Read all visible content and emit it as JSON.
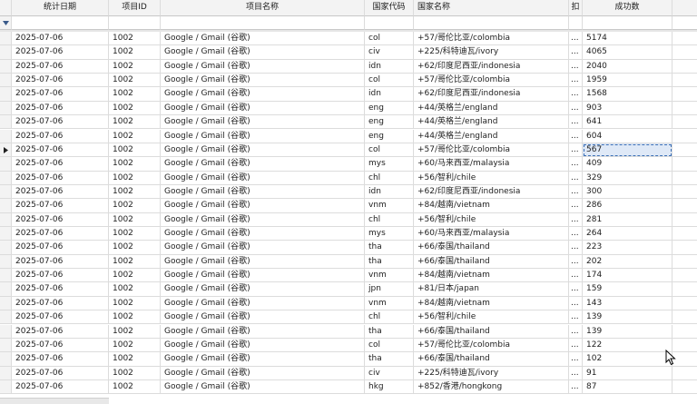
{
  "columns": {
    "date": "统计日期",
    "project_id": "项目ID",
    "project_name": "项目名称",
    "country_code": "国家代码",
    "country_name": "国家名称",
    "d": "扣",
    "success_count": "成功数"
  },
  "filter_icon": "filter-dropdown-icon",
  "row_indicator_icon": "row-pointer-icon",
  "selected_row_index": 8,
  "rows": [
    {
      "date": "2025-07-06",
      "pid": "1002",
      "pname": "Google / Gmail (谷歌)",
      "ccode": "col",
      "cname": "+57/哥伦比亚/colombia",
      "d": "...",
      "ok": "5174"
    },
    {
      "date": "2025-07-06",
      "pid": "1002",
      "pname": "Google / Gmail (谷歌)",
      "ccode": "civ",
      "cname": "+225/科特迪瓦/ivory",
      "d": "...",
      "ok": "4065"
    },
    {
      "date": "2025-07-06",
      "pid": "1002",
      "pname": "Google / Gmail (谷歌)",
      "ccode": "idn",
      "cname": "+62/印度尼西亚/indonesia",
      "d": "...",
      "ok": "2040"
    },
    {
      "date": "2025-07-06",
      "pid": "1002",
      "pname": "Google / Gmail (谷歌)",
      "ccode": "col",
      "cname": "+57/哥伦比亚/colombia",
      "d": "...",
      "ok": "1959"
    },
    {
      "date": "2025-07-06",
      "pid": "1002",
      "pname": "Google / Gmail (谷歌)",
      "ccode": "idn",
      "cname": "+62/印度尼西亚/indonesia",
      "d": "...",
      "ok": "1568"
    },
    {
      "date": "2025-07-06",
      "pid": "1002",
      "pname": "Google / Gmail (谷歌)",
      "ccode": "eng",
      "cname": "+44/英格兰/england",
      "d": "...",
      "ok": "903"
    },
    {
      "date": "2025-07-06",
      "pid": "1002",
      "pname": "Google / Gmail (谷歌)",
      "ccode": "eng",
      "cname": "+44/英格兰/england",
      "d": "...",
      "ok": "641"
    },
    {
      "date": "2025-07-06",
      "pid": "1002",
      "pname": "Google / Gmail (谷歌)",
      "ccode": "eng",
      "cname": "+44/英格兰/england",
      "d": "...",
      "ok": "604"
    },
    {
      "date": "2025-07-06",
      "pid": "1002",
      "pname": "Google / Gmail (谷歌)",
      "ccode": "col",
      "cname": "+57/哥伦比亚/colombia",
      "d": "...",
      "ok": "567"
    },
    {
      "date": "2025-07-06",
      "pid": "1002",
      "pname": "Google / Gmail (谷歌)",
      "ccode": "mys",
      "cname": "+60/马来西亚/malaysia",
      "d": "...",
      "ok": "409"
    },
    {
      "date": "2025-07-06",
      "pid": "1002",
      "pname": "Google / Gmail (谷歌)",
      "ccode": "chl",
      "cname": "+56/智利/chile",
      "d": "...",
      "ok": "329"
    },
    {
      "date": "2025-07-06",
      "pid": "1002",
      "pname": "Google / Gmail (谷歌)",
      "ccode": "idn",
      "cname": "+62/印度尼西亚/indonesia",
      "d": "...",
      "ok": "300"
    },
    {
      "date": "2025-07-06",
      "pid": "1002",
      "pname": "Google / Gmail (谷歌)",
      "ccode": "vnm",
      "cname": "+84/越南/vietnam",
      "d": "...",
      "ok": "286"
    },
    {
      "date": "2025-07-06",
      "pid": "1002",
      "pname": "Google / Gmail (谷歌)",
      "ccode": "chl",
      "cname": "+56/智利/chile",
      "d": "...",
      "ok": "281"
    },
    {
      "date": "2025-07-06",
      "pid": "1002",
      "pname": "Google / Gmail (谷歌)",
      "ccode": "mys",
      "cname": "+60/马来西亚/malaysia",
      "d": "...",
      "ok": "264"
    },
    {
      "date": "2025-07-06",
      "pid": "1002",
      "pname": "Google / Gmail (谷歌)",
      "ccode": "tha",
      "cname": "+66/泰国/thailand",
      "d": "...",
      "ok": "223"
    },
    {
      "date": "2025-07-06",
      "pid": "1002",
      "pname": "Google / Gmail (谷歌)",
      "ccode": "tha",
      "cname": "+66/泰国/thailand",
      "d": "...",
      "ok": "202"
    },
    {
      "date": "2025-07-06",
      "pid": "1002",
      "pname": "Google / Gmail (谷歌)",
      "ccode": "vnm",
      "cname": "+84/越南/vietnam",
      "d": "...",
      "ok": "174"
    },
    {
      "date": "2025-07-06",
      "pid": "1002",
      "pname": "Google / Gmail (谷歌)",
      "ccode": "jpn",
      "cname": "+81/日本/japan",
      "d": "...",
      "ok": "159"
    },
    {
      "date": "2025-07-06",
      "pid": "1002",
      "pname": "Google / Gmail (谷歌)",
      "ccode": "vnm",
      "cname": "+84/越南/vietnam",
      "d": "...",
      "ok": "143"
    },
    {
      "date": "2025-07-06",
      "pid": "1002",
      "pname": "Google / Gmail (谷歌)",
      "ccode": "chl",
      "cname": "+56/智利/chile",
      "d": "...",
      "ok": "139"
    },
    {
      "date": "2025-07-06",
      "pid": "1002",
      "pname": "Google / Gmail (谷歌)",
      "ccode": "tha",
      "cname": "+66/泰国/thailand",
      "d": "...",
      "ok": "139"
    },
    {
      "date": "2025-07-06",
      "pid": "1002",
      "pname": "Google / Gmail (谷歌)",
      "ccode": "col",
      "cname": "+57/哥伦比亚/colombia",
      "d": "...",
      "ok": "122"
    },
    {
      "date": "2025-07-06",
      "pid": "1002",
      "pname": "Google / Gmail (谷歌)",
      "ccode": "tha",
      "cname": "+66/泰国/thailand",
      "d": "...",
      "ok": "102"
    },
    {
      "date": "2025-07-06",
      "pid": "1002",
      "pname": "Google / Gmail (谷歌)",
      "ccode": "civ",
      "cname": "+225/科特迪瓦/ivory",
      "d": "...",
      "ok": "91"
    },
    {
      "date": "2025-07-06",
      "pid": "1002",
      "pname": "Google / Gmail (谷歌)",
      "ccode": "hkg",
      "cname": "+852/香港/hongkong",
      "d": "...",
      "ok": "87"
    }
  ]
}
